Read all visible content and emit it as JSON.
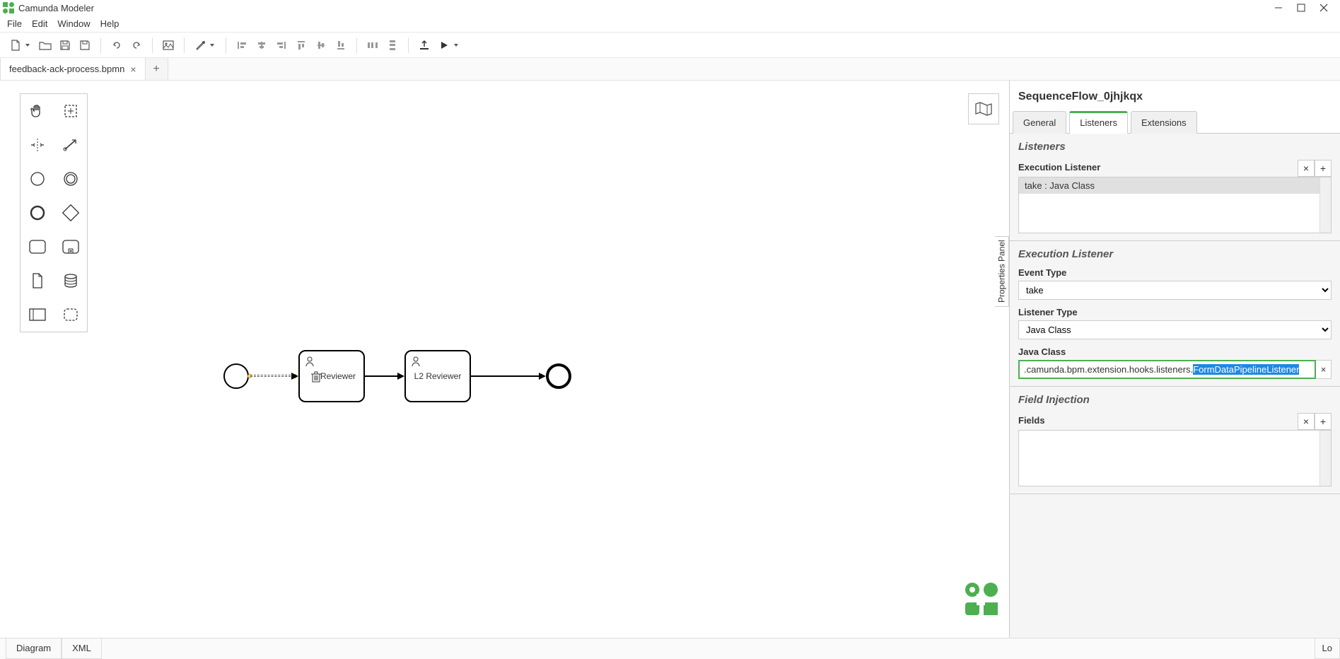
{
  "app": {
    "title": "Camunda Modeler"
  },
  "menubar": [
    "File",
    "Edit",
    "Window",
    "Help"
  ],
  "tab": {
    "name": "feedback-ack-process.bpmn"
  },
  "canvas": {
    "task1": "Reviewer",
    "task2": "L2 Reviewer"
  },
  "props_collapse": "Properties Panel",
  "props": {
    "header": "SequenceFlow_0jhjkqx",
    "tabs": [
      "General",
      "Listeners",
      "Extensions"
    ],
    "active_tab": 1,
    "listeners_section": {
      "title": "Listeners",
      "label": "Execution Listener",
      "item": "take : Java Class"
    },
    "exec_listener": {
      "title": "Execution Listener",
      "event_type_label": "Event Type",
      "event_type_value": "take",
      "listener_type_label": "Listener Type",
      "listener_type_value": "Java Class",
      "java_class_label": "Java Class",
      "java_class_prefix": ".camunda.bpm.extension.hooks.listeners.",
      "java_class_selected": "FormDataPipelineListener"
    },
    "field_injection": {
      "title": "Field Injection",
      "label": "Fields"
    }
  },
  "bottom_tabs": [
    "Diagram",
    "XML"
  ],
  "log_btn": "Lo"
}
